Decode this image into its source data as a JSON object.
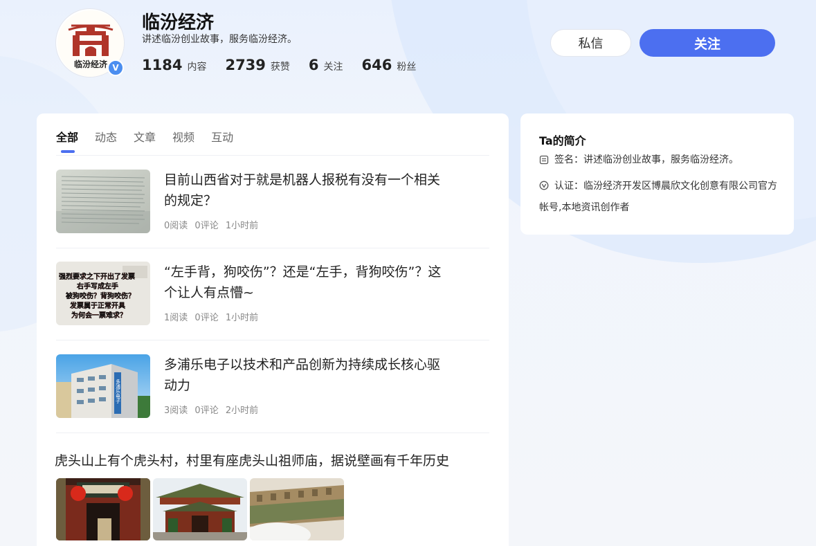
{
  "profile": {
    "name": "临汾经济",
    "signature": "讲述临汾创业故事，服务临汾经济。",
    "avatar_text": "临汾经济",
    "verified_mark": "V",
    "stats": [
      {
        "value": "1184",
        "label": "内容"
      },
      {
        "value": "2739",
        "label": "获赞"
      },
      {
        "value": "6",
        "label": "关注"
      },
      {
        "value": "646",
        "label": "粉丝"
      }
    ]
  },
  "actions": {
    "message_label": "私信",
    "follow_label": "关注"
  },
  "tabs": [
    {
      "label": "全部",
      "active": true
    },
    {
      "label": "动态",
      "active": false
    },
    {
      "label": "文章",
      "active": false
    },
    {
      "label": "视频",
      "active": false
    },
    {
      "label": "互动",
      "active": false
    }
  ],
  "feed": [
    {
      "title": "目前山西省对于就是机器人报税有没有一个相关的规定？",
      "reads": "0阅读",
      "comments": "0评论",
      "time": "1小时前"
    },
    {
      "title": "“左手背，狗咬伤”？还是“左手，背狗咬伤”？这个让人有点懵~",
      "reads": "1阅读",
      "comments": "0评论",
      "time": "1小时前",
      "thumb_lines": [
        "强烈要求之下开出了发票",
        "右手写成左手",
        "被狗咬伤？背狗咬伤？",
        "发票属于正常开具",
        "为何会一票难求？"
      ]
    },
    {
      "title": "多浦乐电子以技术和产品创新为持续成长核心驱动力",
      "reads": "3阅读",
      "comments": "0评论",
      "time": "2小时前",
      "thumb_text": "多浦乐电子"
    }
  ],
  "post4": {
    "title": "虎头山上有个虎头村，村里有座虎头山祖师庙，据说壁画有千年历史"
  },
  "about": {
    "title": "Ta的简介",
    "sign_label": "签名：",
    "sign_value": "讲述临汾创业故事，服务临汾经济。",
    "cert_label": "认证：",
    "cert_value": "临汾经济开发区博晨欣文化创意有限公司官方帐号,本地资讯创作者"
  },
  "colors": {
    "accent": "#4c6ff0",
    "verified": "#4b8ef0"
  }
}
